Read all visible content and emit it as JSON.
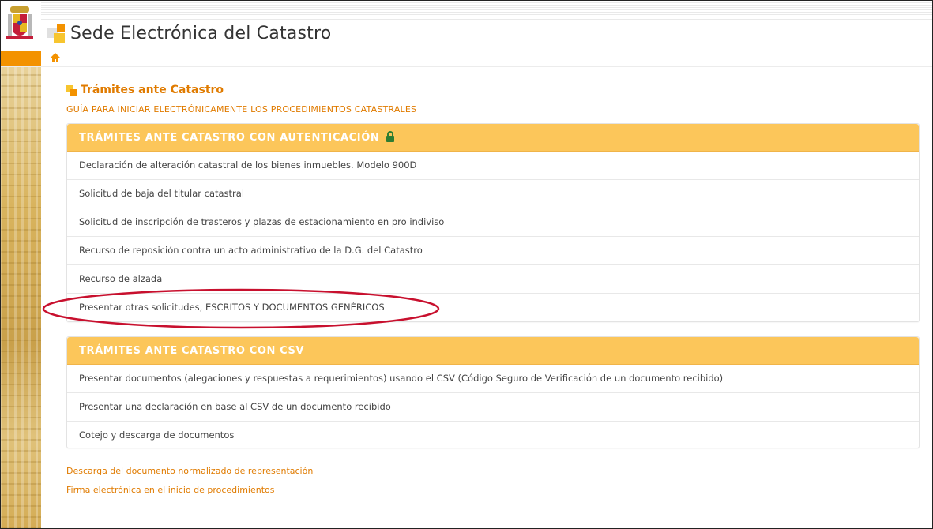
{
  "header": {
    "site_title": "Sede Electrónica del Catastro",
    "brand_colors": {
      "orange": "#f39200",
      "yellow": "#f7c52f"
    }
  },
  "nav": {
    "home_icon": "home-icon"
  },
  "main": {
    "section_title": "Trámites ante Catastro",
    "guide_link": "GUÍA PARA INICIAR ELECTRÓNICAMENTE LOS PROCEDIMIENTOS CATASTRALES",
    "panels": [
      {
        "title": "TRÁMITES ANTE CATASTRO CON AUTENTICACIÓN",
        "icon": "lock-icon",
        "items": [
          "Declaración de alteración catastral de los bienes inmuebles. Modelo 900D",
          "Solicitud de baja del titular catastral",
          "Solicitud de inscripción de trasteros y plazas de estacionamiento en pro indiviso",
          "Recurso de reposición contra un acto administrativo de la D.G. del Catastro",
          "Recurso de alzada",
          "Presentar otras solicitudes, ESCRITOS Y DOCUMENTOS GENÉRICOS"
        ]
      },
      {
        "title": "TRÁMITES ANTE CATASTRO CON CSV",
        "items": [
          "Presentar documentos (alegaciones y respuestas a requerimientos) usando el CSV (Código Seguro de Verificación de un documento recibido)",
          "Presentar una declaración en base al CSV de un documento recibido",
          "Cotejo y descarga de documentos"
        ]
      }
    ],
    "footer_links": [
      "Descarga del documento normalizado de representación",
      "Firma electrónica en el inicio de procedimientos"
    ]
  },
  "colors": {
    "panel_header": "#fcc65a",
    "link": "#e07b00",
    "highlight": "#c8102e"
  }
}
